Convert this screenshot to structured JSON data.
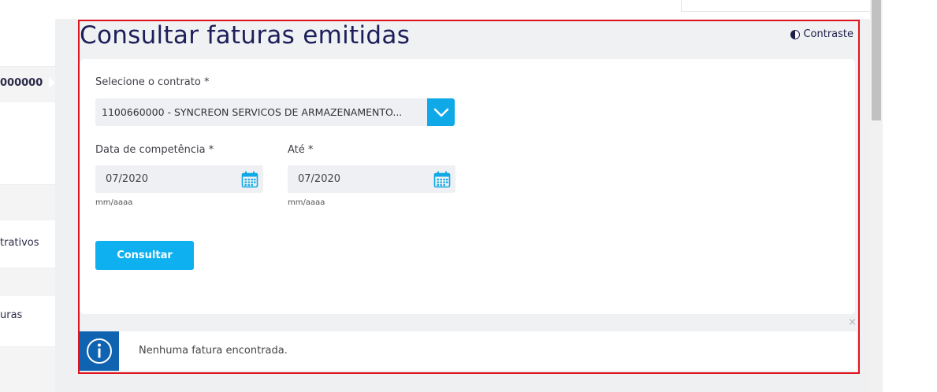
{
  "sidebar": {
    "items": [
      {
        "label": "000000"
      },
      {
        "label": "trativos"
      },
      {
        "label": "uras"
      }
    ]
  },
  "page": {
    "title": "Consultar faturas emitidas",
    "contrast_label": "Contraste"
  },
  "form": {
    "contract_label": "Selecione o contrato *",
    "contract_value": "1100660000 - SYNCREON SERVICOS DE ARMAZENAMENTO...",
    "date_from_label": "Data de competência *",
    "date_from_value": "07/2020",
    "date_from_hint": "mm/aaaa",
    "date_to_label": "Até *",
    "date_to_value": "07/2020",
    "date_to_hint": "mm/aaaa",
    "submit_label": "Consultar"
  },
  "message": {
    "text": "Nenhuma fatura encontrada.",
    "close_glyph": "×"
  },
  "colors": {
    "accent": "#0fb0f0",
    "title": "#1e1e5a",
    "info": "#0f63b0",
    "highlight": "#e0141e"
  }
}
